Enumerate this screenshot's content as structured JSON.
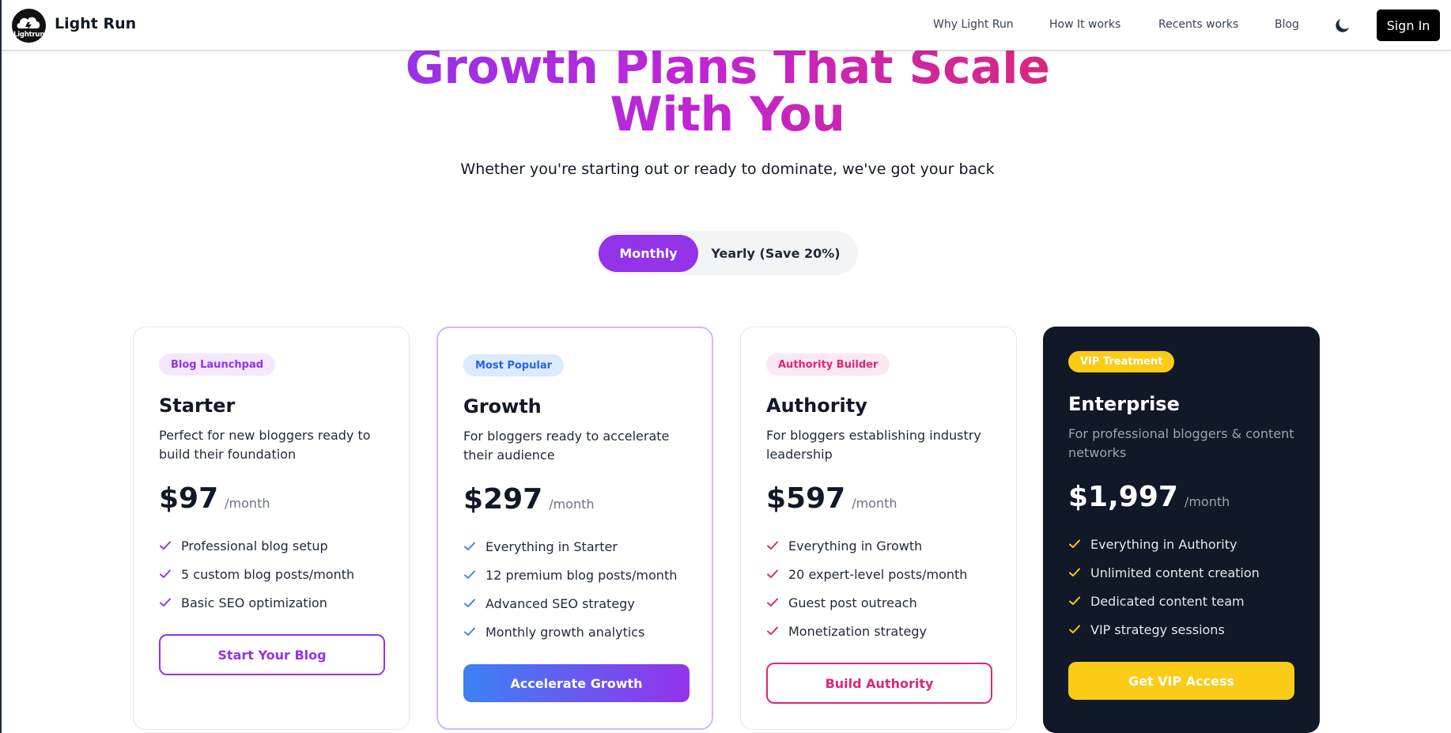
{
  "header": {
    "brand": "Light Run",
    "logo_text": "Lightrun",
    "nav": [
      "Why Light Run",
      "How It works",
      "Recents works",
      "Blog"
    ],
    "theme_icon": "moon-icon",
    "signin_label": "Sign In"
  },
  "hero": {
    "title_line1": "Growth Plans That Scale",
    "title_line2": "With You",
    "subtitle": "Whether you're starting out or ready to dominate, we've got your back"
  },
  "billing_toggle": {
    "monthly_label": "Monthly",
    "yearly_label": "Yearly (Save 20%)",
    "selected": "Monthly"
  },
  "colors": {
    "brand_purple": "#9333ea",
    "pink": "#db2777",
    "blue": "#3b82f6",
    "vip_yellow": "#facc15",
    "vip_bg": "#111827"
  },
  "plans": [
    {
      "badge": "Blog Launchpad",
      "name": "Starter",
      "description": "Perfect for new bloggers ready to build their foundation",
      "price": "$97",
      "period": "/month",
      "features": [
        "Professional blog setup",
        "5 custom blog posts/month",
        "Basic SEO optimization"
      ],
      "cta": "Start Your Blog"
    },
    {
      "badge": "Most Popular",
      "name": "Growth",
      "description": "For bloggers ready to accelerate their audience",
      "price": "$297",
      "period": "/month",
      "features": [
        "Everything in Starter",
        "12 premium blog posts/month",
        "Advanced SEO strategy",
        "Monthly growth analytics"
      ],
      "cta": "Accelerate Growth"
    },
    {
      "badge": "Authority Builder",
      "name": "Authority",
      "description": "For bloggers establishing industry leadership",
      "price": "$597",
      "period": "/month",
      "features": [
        "Everything in Growth",
        "20 expert-level posts/month",
        "Guest post outreach",
        "Monetization strategy"
      ],
      "cta": "Build Authority"
    },
    {
      "badge": "VIP Treatment",
      "name": "Enterprise",
      "description": "For professional bloggers & content networks",
      "price": "$1,997",
      "period": "/month",
      "features": [
        "Everything in Authority",
        "Unlimited content creation",
        "Dedicated content team",
        "VIP strategy sessions"
      ],
      "cta": "Get VIP Access"
    }
  ]
}
